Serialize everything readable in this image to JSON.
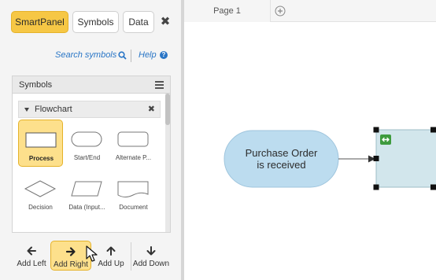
{
  "panel": {
    "tabs": [
      "SmartPanel",
      "Symbols",
      "Data"
    ],
    "close_label": "✖",
    "search_link": "Search symbols",
    "help_link": "Help",
    "symbols_title": "Symbols",
    "flowchart": {
      "title": "Flowchart",
      "close_label": "✖",
      "shapes": [
        {
          "label": "Process",
          "selected": true
        },
        {
          "label": "Start/End"
        },
        {
          "label": "Alternate P..."
        },
        {
          "label": "Decision"
        },
        {
          "label": "Data (Input..."
        },
        {
          "label": "Document"
        }
      ]
    }
  },
  "toolbar": {
    "add_left": "Add Left",
    "add_right": "Add Right",
    "add_up": "Add Up",
    "add_down": "Add Down"
  },
  "canvas": {
    "page_tab": "Page 1",
    "shape_line1": "Purchase Order",
    "shape_line2": "is received"
  },
  "colors": {
    "accent": "#f6c745",
    "selected_fill": "#fde08c",
    "shape_fill": "#bcdcef",
    "new_shape_fill": "#d2e6ec",
    "link": "#2a76c6",
    "badge": "#3e9b3e"
  },
  "icons": [
    "close-icon",
    "search-icon",
    "help-icon",
    "hamburger-menu-icon",
    "caret-down-icon",
    "arrow-left-icon",
    "arrow-right-icon",
    "arrow-up-icon",
    "arrow-down-icon",
    "plus-circle-icon",
    "cursor-icon",
    "swap-icon"
  ]
}
